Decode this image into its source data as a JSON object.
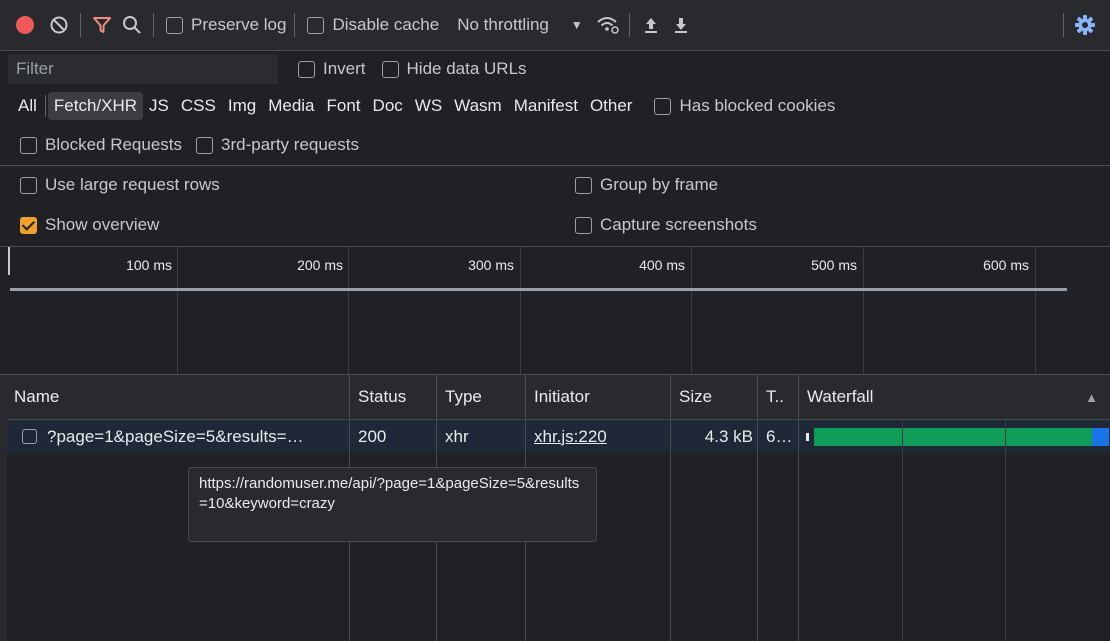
{
  "toolbar": {
    "preserve_log_label": "Preserve log",
    "preserve_log_checked": false,
    "disable_cache_label": "Disable cache",
    "disable_cache_checked": false,
    "throttling_value": "No throttling",
    "throttling_caret": "▼",
    "colors": {
      "record": "#ee5a5a",
      "filter_active": "#f28b82",
      "settings": "#8ab4f8"
    }
  },
  "filter": {
    "placeholder": "Filter",
    "invert_label": "Invert",
    "invert_checked": false,
    "hide_data_urls_label": "Hide data URLs",
    "hide_data_urls_checked": false
  },
  "resource_types": {
    "items": [
      "All",
      "Fetch/XHR",
      "JS",
      "CSS",
      "Img",
      "Media",
      "Font",
      "Doc",
      "WS",
      "Wasm",
      "Manifest",
      "Other"
    ],
    "selected": "Fetch/XHR",
    "has_blocked_cookies_label": "Has blocked cookies"
  },
  "blocked": {
    "blocked_requests_label": "Blocked Requests",
    "third_party_label": "3rd-party requests"
  },
  "settings": {
    "large_rows_label": "Use large request rows",
    "large_rows_checked": false,
    "group_by_frame_label": "Group by frame",
    "group_by_frame_checked": false,
    "show_overview_label": "Show overview",
    "show_overview_checked": true,
    "capture_screenshots_label": "Capture screenshots",
    "capture_screenshots_checked": false
  },
  "overview": {
    "ticks": [
      "100 ms",
      "200 ms",
      "300 ms",
      "400 ms",
      "500 ms",
      "600 ms"
    ]
  },
  "table": {
    "columns": {
      "name": "Name",
      "status": "Status",
      "type": "Type",
      "initiator": "Initiator",
      "size": "Size",
      "time": "T..",
      "waterfall": "Waterfall",
      "sort_icon": "▲"
    },
    "rows": [
      {
        "name": "?page=1&pageSize=5&results=…",
        "status": "200",
        "type": "xhr",
        "initiator": "xhr.js:220",
        "size": "4.3 kB",
        "time": "6…"
      }
    ],
    "waterfall_colors": {
      "waiting": "#0f9d58",
      "receiving": "#1a73e8"
    }
  },
  "tooltip": {
    "text": "https://randomuser.me/api/?page=1&pageSize=5&results=10&keyword=crazy"
  }
}
